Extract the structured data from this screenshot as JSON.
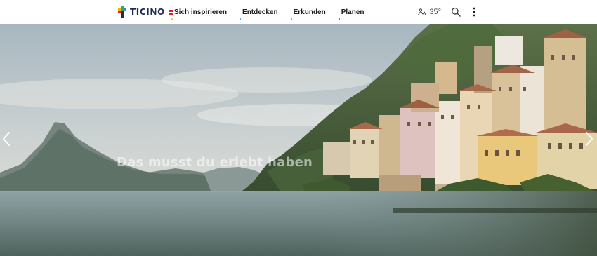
{
  "header": {
    "logo_text": "TICINO",
    "nav": [
      {
        "label": "Sich inspirieren",
        "dot_color": "#f0b400"
      },
      {
        "label": "Entdecken",
        "dot_color": "#2e8bd6"
      },
      {
        "label": "Erkunden",
        "dot_color": "#3aaa4a"
      },
      {
        "label": "Planen",
        "dot_color": "#d8232a"
      }
    ],
    "weather_temp": "35°"
  },
  "hero": {
    "title": "Das musst du erlebt haben"
  },
  "colors": {
    "brand_navy": "#1f2a55",
    "flag_red": "#d8232a"
  },
  "icons": [
    "ticino-logo-icon",
    "swiss-flag-icon",
    "weather-icon",
    "search-icon",
    "more-vertical-icon",
    "chevron-left-icon",
    "chevron-right-icon"
  ]
}
